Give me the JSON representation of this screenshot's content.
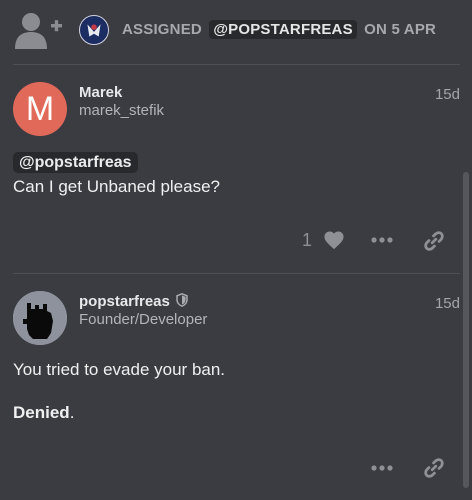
{
  "assignment": {
    "prefix": "ASSIGNED",
    "assignee": "@POPSTARFREAS",
    "suffix": "ON 5 APR"
  },
  "posts": [
    {
      "author_name": "Marek",
      "author_username": "marek_stefik",
      "avatar_letter": "M",
      "avatar_color": "#e1695a",
      "date": "15d",
      "mention": "@popstarfreas",
      "body": "Can I get Unbaned please?",
      "like_count": "1"
    },
    {
      "author_name": "popstarfreas",
      "author_title": "Founder/Developer",
      "date": "15d",
      "body_line1": "You tried to evade your ban.",
      "body_line2_bold": "Denied",
      "body_line2_rest": "."
    }
  ],
  "icons": {
    "add_user": "add-user-icon",
    "shield": "shield-icon",
    "heart": "heart-icon",
    "more": "ellipsis-icon",
    "link": "link-icon"
  }
}
